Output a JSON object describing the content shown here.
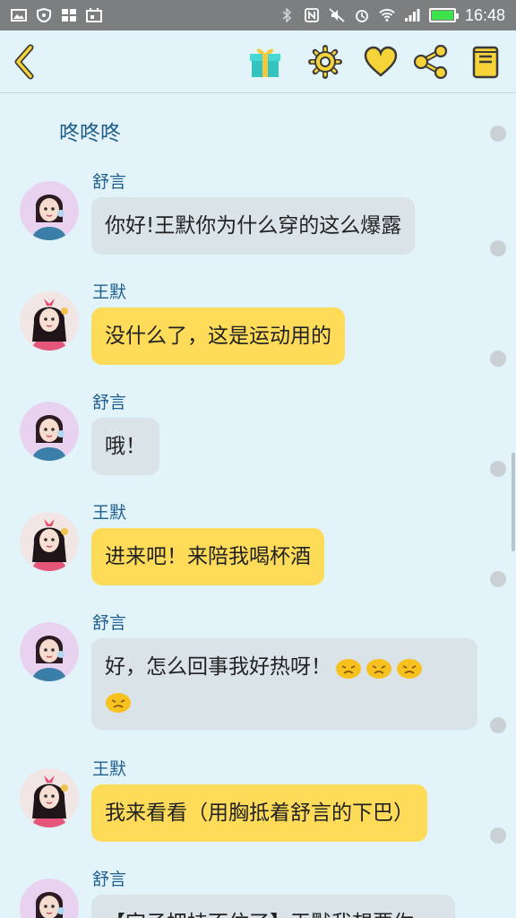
{
  "status_bar": {
    "time": "16:48",
    "left_icons": [
      "image-icon",
      "shield-icon",
      "apps-grid-icon",
      "calendar-icon"
    ],
    "right_icons": [
      "bluetooth-icon",
      "nfc-icon",
      "mute-icon",
      "alarm-icon",
      "wifi-icon",
      "signal-icon",
      "battery-icon"
    ],
    "battery_color": "#3ee24a"
  },
  "toolbar": {
    "icons": [
      "back-icon",
      "gift-icon",
      "settings-icon",
      "heart-icon",
      "share-icon",
      "notebook-icon"
    ],
    "accent": "#f7d33a"
  },
  "chat": {
    "title": "咚咚咚",
    "messages": [
      {
        "sender": "舒言",
        "text": "你好!王默你为什么穿的这么爆露",
        "style": "grey"
      },
      {
        "sender": "王默",
        "text": "没什么了，这是运动用的",
        "style": "yellow"
      },
      {
        "sender": "舒言",
        "text": "哦！",
        "style": "grey"
      },
      {
        "sender": "王默",
        "text": "进来吧！来陪我喝杯酒",
        "style": "yellow"
      },
      {
        "sender": "舒言",
        "text": "好，怎么回事我好热呀！",
        "style": "grey",
        "emojis": [
          "hot-face-emoji",
          "hot-face-emoji",
          "hot-face-emoji",
          "hot-face-emoji"
        ]
      },
      {
        "sender": "王默",
        "text": "我来看看（用胸抵着舒言的下巴）",
        "style": "yellow"
      },
      {
        "sender": "舒言",
        "text": "【宫子把持不住了】王默我想要你",
        "style": "grey"
      }
    ]
  }
}
